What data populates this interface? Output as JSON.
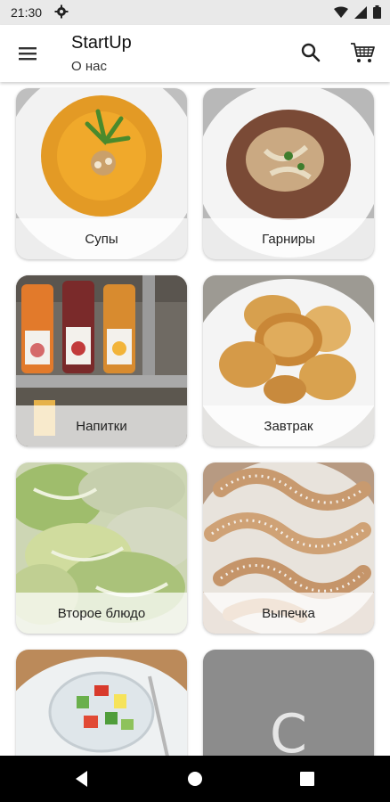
{
  "status_bar": {
    "time": "21:30",
    "icons": [
      "gear-icon",
      "wifi-icon",
      "signal-icon",
      "battery-icon"
    ]
  },
  "app_bar": {
    "title": "StartUp",
    "subtitle": "О нас",
    "icons": [
      "menu-icon",
      "search-icon",
      "cart-icon"
    ]
  },
  "categories": [
    {
      "label": "Супы"
    },
    {
      "label": "Гарниры"
    },
    {
      "label": "Напитки"
    },
    {
      "label": "Завтрак"
    },
    {
      "label": "Второе блюдо"
    },
    {
      "label": "Выпечка"
    },
    {
      "label": ""
    },
    {
      "placeholder_letter": "C"
    }
  ],
  "nav_bar": {
    "icons": [
      "back-icon",
      "home-icon",
      "recents-icon"
    ]
  },
  "colors": {
    "status_bar_bg": "#e9e9e9",
    "nav_bar_bg": "#000000",
    "placeholder_card_bg": "#8c8c8c"
  }
}
